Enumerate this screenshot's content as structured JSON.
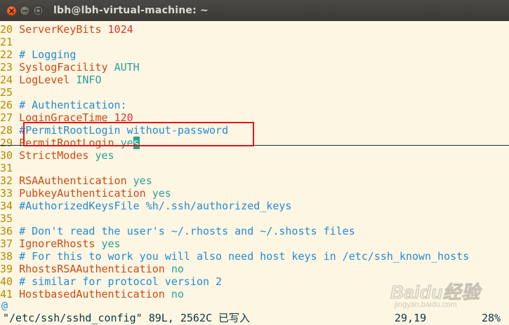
{
  "window": {
    "title": "lbh@lbh-virtual-machine: ~"
  },
  "editor": {
    "lines": [
      {
        "num": "20",
        "key": "ServerKeyBits",
        "val": "1024",
        "val_kind": "num"
      },
      {
        "num": "21"
      },
      {
        "num": "22",
        "comment": "# Logging"
      },
      {
        "num": "23",
        "key": "SyslogFacility",
        "val": "AUTH",
        "val_kind": "val"
      },
      {
        "num": "24",
        "key": "LogLevel",
        "val": "INFO",
        "val_kind": "val"
      },
      {
        "num": "25"
      },
      {
        "num": "26",
        "comment": "# Authentication:"
      },
      {
        "num": "27",
        "key": "LoginGraceTime",
        "val": "120",
        "val_kind": "num"
      },
      {
        "num": "28",
        "comment": "#PermitRootLogin without-password"
      },
      {
        "num": "29",
        "key": "PermitRootLogin",
        "val": "ye",
        "cursor": "s",
        "val_kind": "val"
      },
      {
        "num": "30",
        "key": "StrictModes",
        "val": "yes",
        "val_kind": "val"
      },
      {
        "num": "31"
      },
      {
        "num": "32",
        "key": "RSAAuthentication",
        "val": "yes",
        "val_kind": "val"
      },
      {
        "num": "33",
        "key": "PubkeyAuthentication",
        "val": "yes",
        "val_kind": "val"
      },
      {
        "num": "34",
        "comment": "#AuthorizedKeysFile %h/.ssh/authorized_keys"
      },
      {
        "num": "35"
      },
      {
        "num": "36",
        "comment": "# Don't read the user's ~/.rhosts and ~/.shosts files"
      },
      {
        "num": "37",
        "key": "IgnoreRhosts",
        "val": "yes",
        "val_kind": "val"
      },
      {
        "num": "38",
        "comment": "# For this to work you will also need host keys in /etc/ssh_known_hosts"
      },
      {
        "num": "39",
        "key": "RhostsRSAAuthentication",
        "val": "no",
        "val_kind": "val"
      },
      {
        "num": "40",
        "comment": "# similar for protocol version 2"
      },
      {
        "num": "41",
        "key": "HostbasedAuthentication",
        "val": "no",
        "val_kind": "val"
      }
    ],
    "filler": "@"
  },
  "status": {
    "message": "\"/etc/ssh/sshd_config\" 89L, 2562C 已写入",
    "position": "29,19",
    "percent": "28%"
  },
  "watermark": {
    "logo": "Baidu经验",
    "sub": "jingyan.baidu.com"
  },
  "colors": {
    "background": "#fdf6e3",
    "line_number": "#b58900",
    "comment": "#268bd2",
    "keyword": "#cb4b16",
    "value": "#2aa198",
    "number": "#dc322f",
    "highlight_box": "#e0161e"
  },
  "icons": {
    "close": "close-icon",
    "minimize": "minimize-icon",
    "maximize": "maximize-icon"
  }
}
